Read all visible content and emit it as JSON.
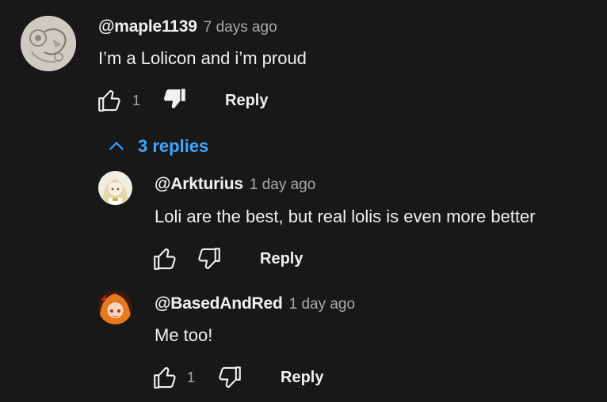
{
  "thread": {
    "comment": {
      "author": "@maple1139",
      "time": "7 days ago",
      "text": "I’m a Lolicon and i’m proud",
      "like_count": "1",
      "reply_label": "Reply",
      "disliked": true
    },
    "replies_toggle": {
      "label": "3 replies",
      "expanded": true
    },
    "replies": [
      {
        "author": "@Arkturius",
        "time": "1 day ago",
        "text": "Loli are the best, but real lolis is even more better",
        "like_count": "",
        "reply_label": "Reply"
      },
      {
        "author": "@BasedAndRed",
        "time": "1 day ago",
        "text": "Me too!",
        "like_count": "1",
        "reply_label": "Reply"
      }
    ]
  },
  "colors": {
    "background": "#181818",
    "text_primary": "#f1f1f1",
    "text_secondary": "#aaaaaa",
    "accent_link": "#3ea6ff"
  },
  "icons": {
    "like": "thumbs-up-icon",
    "dislike": "thumbs-down-icon",
    "collapse": "chevron-up-icon"
  }
}
